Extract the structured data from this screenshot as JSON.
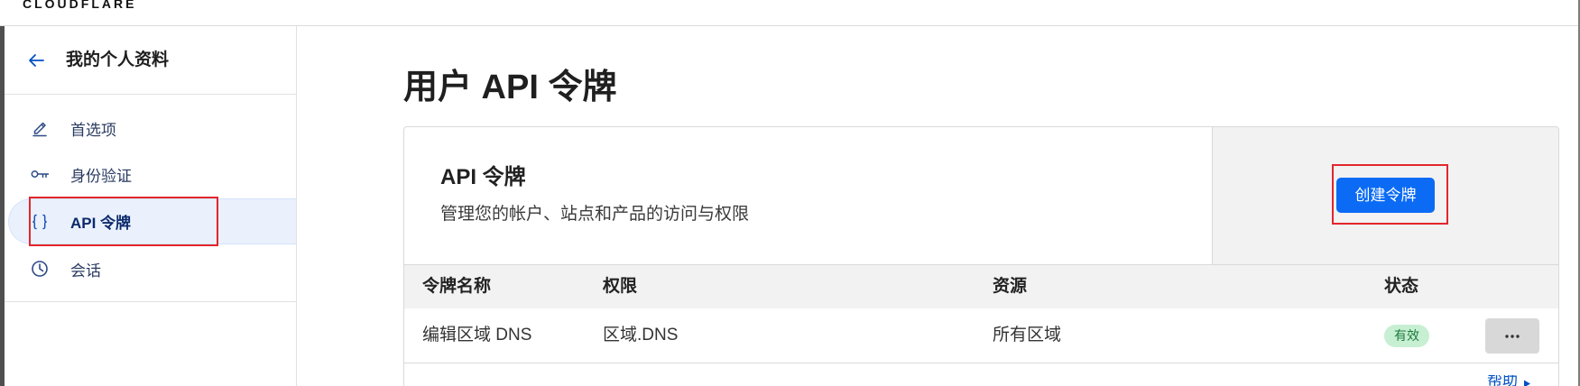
{
  "header": {
    "logo_text": "CLOUDFLARE"
  },
  "sidebar": {
    "back_icon": "arrow-left-icon",
    "title": "我的个人资料",
    "items": [
      {
        "label": "首选项",
        "icon": "pencil-icon",
        "active": false
      },
      {
        "label": "身份验证",
        "icon": "key-icon",
        "active": false
      },
      {
        "label": "API 令牌",
        "icon": "braces-icon",
        "active": true
      },
      {
        "label": "会话",
        "icon": "clock-icon",
        "active": false
      }
    ]
  },
  "main": {
    "page_title": "用户 API 令牌",
    "card": {
      "title": "API 令牌",
      "description": "管理您的帐户、站点和产品的访问与权限",
      "create_button_label": "创建令牌",
      "table": {
        "columns": [
          "令牌名称",
          "权限",
          "资源",
          "状态"
        ],
        "rows": [
          {
            "name": "编辑区域 DNS",
            "permission": "区域.DNS",
            "resource": "所有区域",
            "status": "有效",
            "actions_icon": "more-horizontal-icon"
          }
        ]
      }
    },
    "help_link": {
      "label": "帮助",
      "icon": "caret-right-icon"
    }
  },
  "colors": {
    "accent": "#0051c3",
    "primary_button": "#0b6bf5",
    "active_item_bg": "#eaf1fd",
    "status_badge_bg": "#c7efd2",
    "status_badge_text": "#1e7a3c",
    "annotation_red": "#e3262c"
  }
}
